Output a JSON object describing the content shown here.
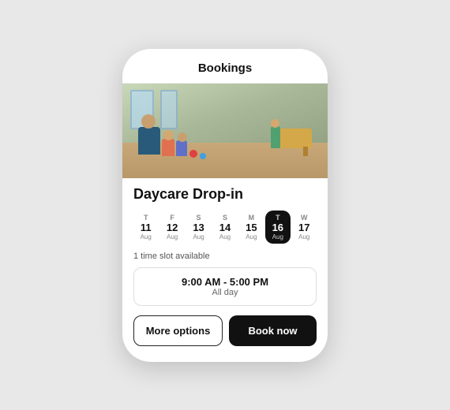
{
  "header": {
    "title": "Bookings"
  },
  "event": {
    "title": "Daycare Drop-in",
    "image_alt": "Daycare classroom with children and caregiver"
  },
  "dates": [
    {
      "id": "d1",
      "day_letter": "T",
      "day_num": "11",
      "month": "Aug",
      "active": false
    },
    {
      "id": "d2",
      "day_letter": "F",
      "day_num": "12",
      "month": "Aug",
      "active": false
    },
    {
      "id": "d3",
      "day_letter": "S",
      "day_num": "13",
      "month": "Aug",
      "active": false
    },
    {
      "id": "d4",
      "day_letter": "S",
      "day_num": "14",
      "month": "Aug",
      "active": false
    },
    {
      "id": "d5",
      "day_letter": "M",
      "day_num": "15",
      "month": "Aug",
      "active": false
    },
    {
      "id": "d6",
      "day_letter": "T",
      "day_num": "16",
      "month": "Aug",
      "active": true
    },
    {
      "id": "d7",
      "day_letter": "W",
      "day_num": "17",
      "month": "Aug",
      "active": false
    }
  ],
  "slots": {
    "label": "1 time slot available",
    "time_range": "9:00 AM - 5:00 PM",
    "time_sub": "All day"
  },
  "buttons": {
    "more_options": "More options",
    "book_now": "Book now"
  }
}
